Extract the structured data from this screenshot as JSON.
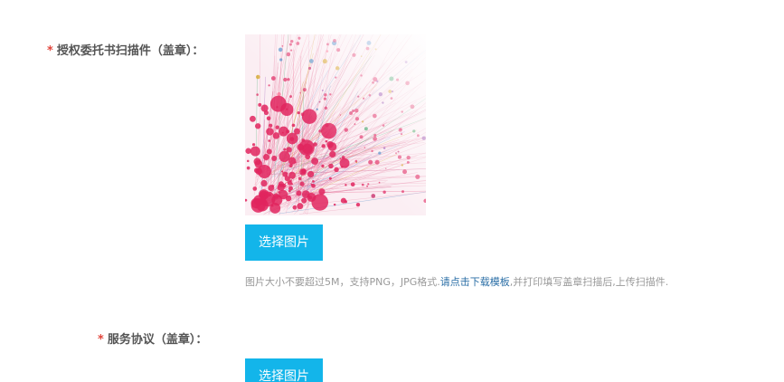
{
  "form": {
    "field_auth": {
      "required_mark": "*",
      "label": "授权委托书扫描件（盖章）："
    },
    "upload_button_1": "选择图片",
    "hint": {
      "before": "图片大小不要超过5M，支持PNG，JPG格式.",
      "link": "请点击下载模板",
      "after": ",并打印填写盖章扫描后,上传扫描件."
    },
    "field_service": {
      "required_mark": "*",
      "label": "服务协议（盖章）："
    },
    "upload_button_2": "选择图片"
  },
  "colors": {
    "required": "#e2463c",
    "button": "#13b5ea",
    "link": "#2a6ea6",
    "label": "#555555",
    "hint": "#999999",
    "preview_main": "#e0245e"
  }
}
